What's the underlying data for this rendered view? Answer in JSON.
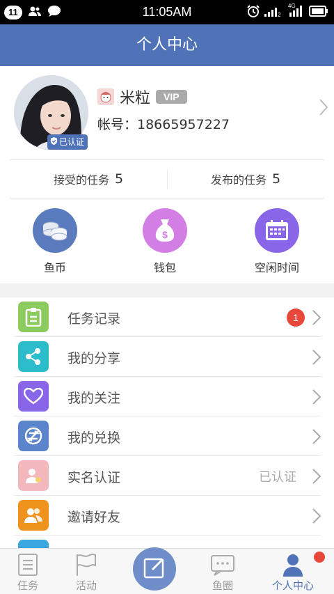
{
  "status_bar": {
    "notif_count": "11",
    "time": "11:05AM",
    "network": "4G"
  },
  "title": "个人中心",
  "profile": {
    "name": "米粒",
    "vip": "VIP",
    "account": "帐号：18665957227",
    "verified": "已认证"
  },
  "stats": [
    {
      "label": "接受的任务",
      "value": "5"
    },
    {
      "label": "发布的任务",
      "value": "5"
    }
  ],
  "quick_actions": [
    {
      "label": "鱼币",
      "icon": "coins-icon",
      "color": "#5b7bbf"
    },
    {
      "label": "钱包",
      "icon": "money-bag-icon",
      "color": "#d27ee4"
    },
    {
      "label": "空闲时间",
      "icon": "calendar-icon",
      "color": "#8966e8"
    }
  ],
  "menu": [
    {
      "label": "任务记录",
      "icon": "clipboard-icon",
      "color": "#8ccb5e",
      "badge": "1"
    },
    {
      "label": "我的分享",
      "icon": "share-icon",
      "color": "#2cbccb"
    },
    {
      "label": "我的关注",
      "icon": "heart-icon",
      "color": "#8966e8"
    },
    {
      "label": "我的兑换",
      "icon": "exchange-icon",
      "color": "#5b84cc"
    },
    {
      "label": "实名认证",
      "icon": "id-card-icon",
      "color": "#f2b8bd",
      "value": "已认证"
    },
    {
      "label": "邀请好友",
      "icon": "invite-friends-icon",
      "color": "#f0921e"
    }
  ],
  "tabbar": {
    "tabs": [
      {
        "label": "任务",
        "icon": "task-icon"
      },
      {
        "label": "活动",
        "icon": "flag-icon"
      },
      {
        "label": "鱼圈",
        "icon": "chat-icon"
      },
      {
        "label": "个人中心",
        "icon": "profile-icon",
        "active": true
      }
    ],
    "active_color": "#4f73b6"
  },
  "colors": {
    "primary": "#4f73b6",
    "badge_red": "#e8483b"
  }
}
